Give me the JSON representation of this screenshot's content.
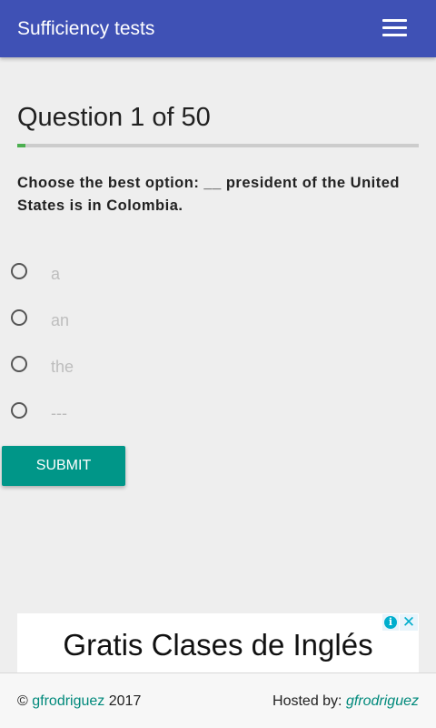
{
  "appbar": {
    "title": "Sufficiency tests",
    "menu_icon": "hamburger-menu-icon"
  },
  "quiz": {
    "heading": "Question 1 of 50",
    "progress": {
      "current": 1,
      "total": 50,
      "fraction": 0.02,
      "color": "#4caf50"
    },
    "question": "Choose the best option: __ president of the United States is in Colombia.",
    "options": [
      {
        "label": "a"
      },
      {
        "label": "an"
      },
      {
        "label": "the"
      },
      {
        "label": "---"
      }
    ],
    "submit_label": "SUBMIT"
  },
  "ad": {
    "text": "Gratis Clases de Inglés",
    "info_icon": "ad-info-icon",
    "close_icon": "ad-close-icon",
    "info_glyph": "i",
    "close_glyph": "✕"
  },
  "footer": {
    "copyright_symbol": "©",
    "author_link": "gfrodriguez",
    "year": "2017",
    "hosted_label": "Hosted by:",
    "host_link": "gfrodriguez"
  },
  "colors": {
    "primary": "#3f51b5",
    "accent": "#009688",
    "progress": "#4caf50",
    "link": "#00897b"
  }
}
